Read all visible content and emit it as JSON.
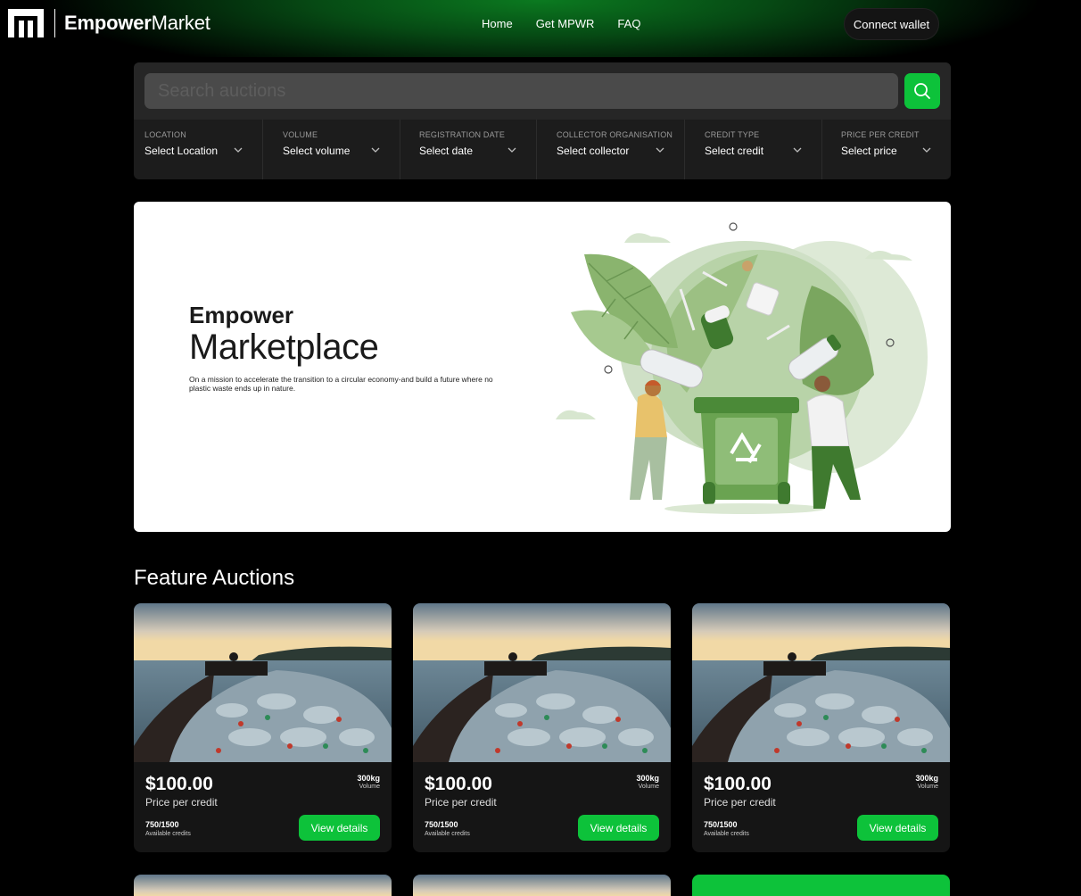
{
  "header": {
    "brand_bold": "Empower",
    "brand_light": "Market",
    "nav": [
      "Home",
      "Get MPWR",
      "FAQ"
    ],
    "connect_label": "Connect wallet"
  },
  "search": {
    "placeholder": "Search auctions",
    "filters": [
      {
        "label": "LOCATION",
        "value": "Select Location"
      },
      {
        "label": "VOLUME",
        "value": "Select volume"
      },
      {
        "label": "REGISTRATION DATE",
        "value": "Select date"
      },
      {
        "label": "COLLECTOR ORGANISATION",
        "value": "Select collector"
      },
      {
        "label": "CREDIT TYPE",
        "value": "Select credit"
      },
      {
        "label": "PRICE PER CREDIT",
        "value": "Select price"
      }
    ]
  },
  "hero": {
    "title_bold": "Empower",
    "title_light": "Marketplace",
    "description": "On a mission to accelerate the transition to a circular economy-and build a future where no plastic waste ends up in nature."
  },
  "section": {
    "title": "Feature Auctions"
  },
  "cards": [
    {
      "price": "$100.00",
      "price_label": "Price per credit",
      "volume": "300kg",
      "volume_label": "Volume",
      "credits": "750/1500",
      "credits_label": "Available credits",
      "button": "View details"
    },
    {
      "price": "$100.00",
      "price_label": "Price per credit",
      "volume": "300kg",
      "volume_label": "Volume",
      "credits": "750/1500",
      "credits_label": "Available credits",
      "button": "View details"
    },
    {
      "price": "$100.00",
      "price_label": "Price per credit",
      "volume": "300kg",
      "volume_label": "Volume",
      "credits": "750/1500",
      "credits_label": "Available credits",
      "button": "View details"
    }
  ],
  "colors": {
    "accent": "#0dc23a",
    "header_glow": "#0b7a20",
    "panel": "#1c1c1c"
  },
  "icons": {
    "search": "search-icon",
    "chevron": "chevron-down-icon",
    "logo": "logo-icon"
  }
}
